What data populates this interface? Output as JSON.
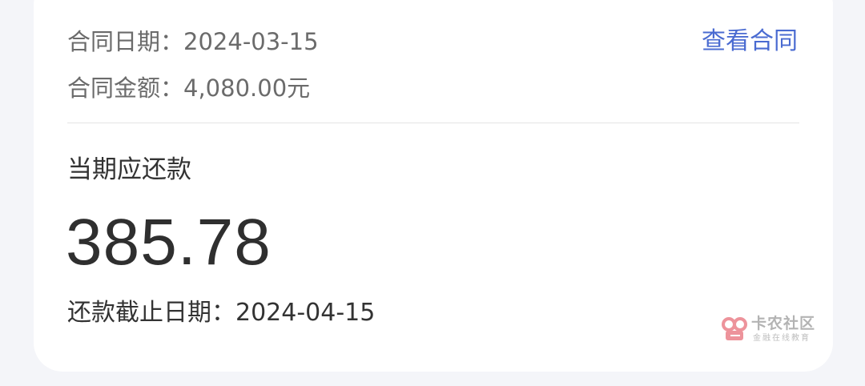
{
  "contract": {
    "date_label": "合同日期：",
    "date_value": "2024-03-15",
    "amount_label": "合同金额：",
    "amount_value": "4,080.00元",
    "view_link": "查看合同"
  },
  "payment": {
    "due_label": "当期应还款",
    "due_amount": "385.78",
    "deadline_label": "还款截止日期：",
    "deadline_value": "2024-04-15"
  },
  "watermark": {
    "title": "卡农社区",
    "subtitle": "金融在线教育",
    "icon": "kanong-logo-icon"
  },
  "colors": {
    "link": "#4a6bd1",
    "background": "#f4f5f9",
    "card": "#ffffff",
    "watermark_accent": "#e8707a"
  }
}
